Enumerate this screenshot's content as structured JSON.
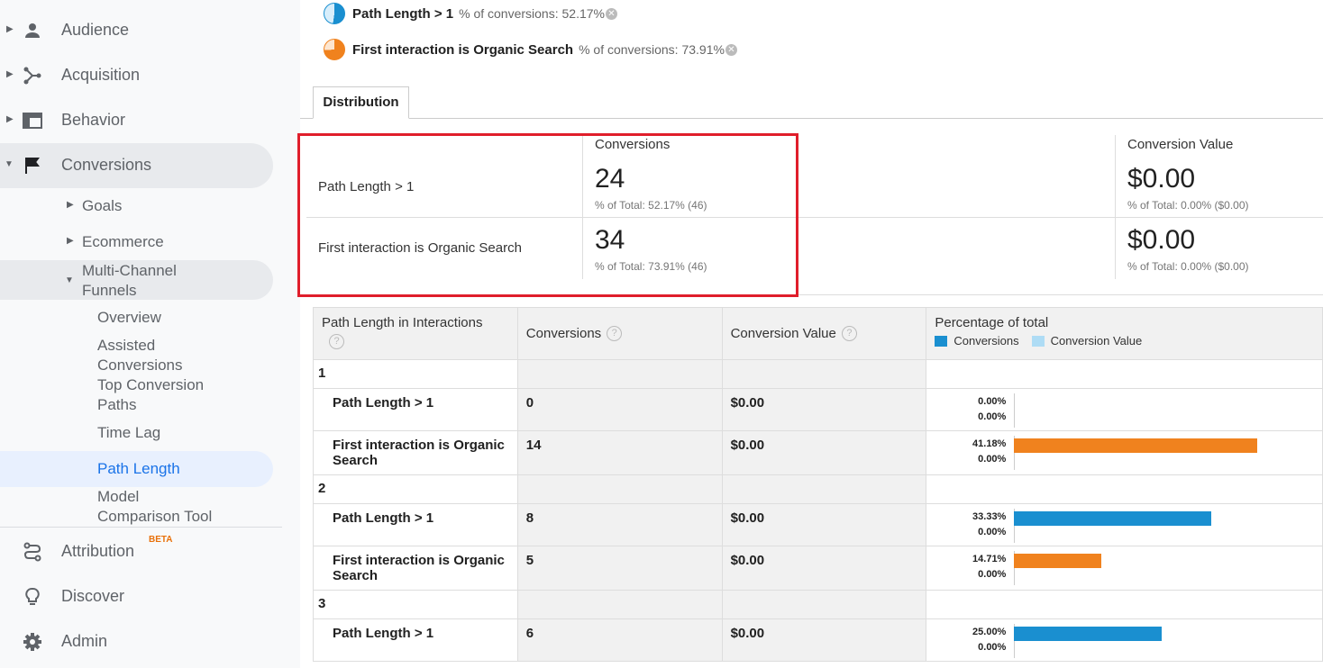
{
  "sidebar": {
    "items": [
      {
        "label": "Audience",
        "icon": "person-icon"
      },
      {
        "label": "Acquisition",
        "icon": "acquisition-icon"
      },
      {
        "label": "Behavior",
        "icon": "behavior-icon"
      },
      {
        "label": "Conversions",
        "icon": "flag-icon"
      }
    ],
    "sub": {
      "goals": "Goals",
      "ecommerce": "Ecommerce",
      "mcf_line1": "Multi-Channel",
      "mcf_line2": "Funnels"
    },
    "leaves": {
      "overview": "Overview",
      "assisted_1": "Assisted",
      "assisted_2": "Conversions",
      "top_1": "Top Conversion",
      "top_2": "Paths",
      "time_lag": "Time Lag",
      "path_length": "Path Length",
      "model_1": "Model",
      "model_2": "Comparison Tool"
    },
    "bottom": {
      "attribution": "Attribution",
      "beta": "BETA",
      "discover": "Discover",
      "admin": "Admin"
    }
  },
  "segments": [
    {
      "name": "Path Length > 1",
      "stat": "% of conversions: 52.17%",
      "color": "#1a8fd0"
    },
    {
      "name": "First interaction is Organic Search",
      "stat": "% of conversions: 73.91%",
      "color": "#f0821e"
    }
  ],
  "tab": "Distribution",
  "summary": {
    "conversions_header": "Conversions",
    "value_header": "Conversion Value",
    "rows": [
      {
        "label": "Path Length > 1",
        "conversions": "24",
        "conv_sub": "% of Total: 52.17% (46)",
        "value": "$0.00",
        "value_sub": "% of Total: 0.00% ($0.00)"
      },
      {
        "label": "First interaction is Organic Search",
        "conversions": "34",
        "conv_sub": "% of Total: 73.91% (46)",
        "value": "$0.00",
        "value_sub": "% of Total: 0.00% ($0.00)"
      }
    ]
  },
  "table": {
    "headers": {
      "path_length": "Path Length in Interactions",
      "conversions": "Conversions",
      "value": "Conversion Value",
      "pct": "Percentage of total",
      "legend_conv": "Conversions",
      "legend_value": "Conversion Value"
    },
    "help": "?",
    "groups": [
      {
        "label": "1",
        "rows": [
          {
            "name": "Path Length > 1",
            "conversions": "0",
            "value": "$0.00",
            "pct_conv": "0.00%",
            "pct_value": "0.00%",
            "fraction": 0.0,
            "color": "#1a8fd0"
          },
          {
            "name": "First interaction is Organic Search",
            "conversions": "14",
            "value": "$0.00",
            "pct_conv": "41.18%",
            "pct_value": "0.00%",
            "fraction": 0.4118,
            "color": "#f0821e"
          }
        ]
      },
      {
        "label": "2",
        "rows": [
          {
            "name": "Path Length > 1",
            "conversions": "8",
            "value": "$0.00",
            "pct_conv": "33.33%",
            "pct_value": "0.00%",
            "fraction": 0.3333,
            "color": "#1a8fd0"
          },
          {
            "name": "First interaction is Organic Search",
            "conversions": "5",
            "value": "$0.00",
            "pct_conv": "14.71%",
            "pct_value": "0.00%",
            "fraction": 0.1471,
            "color": "#f0821e"
          }
        ]
      },
      {
        "label": "3",
        "rows": [
          {
            "name": "Path Length > 1",
            "conversions": "6",
            "value": "$0.00",
            "pct_conv": "25.00%",
            "pct_value": "0.00%",
            "fraction": 0.25,
            "color": "#1a8fd0"
          }
        ]
      }
    ]
  },
  "colors": {
    "conversions": "#1a8fd0",
    "conversion_value": "#aedcf5",
    "organic": "#f0821e",
    "highlight": "#e01e2b"
  }
}
